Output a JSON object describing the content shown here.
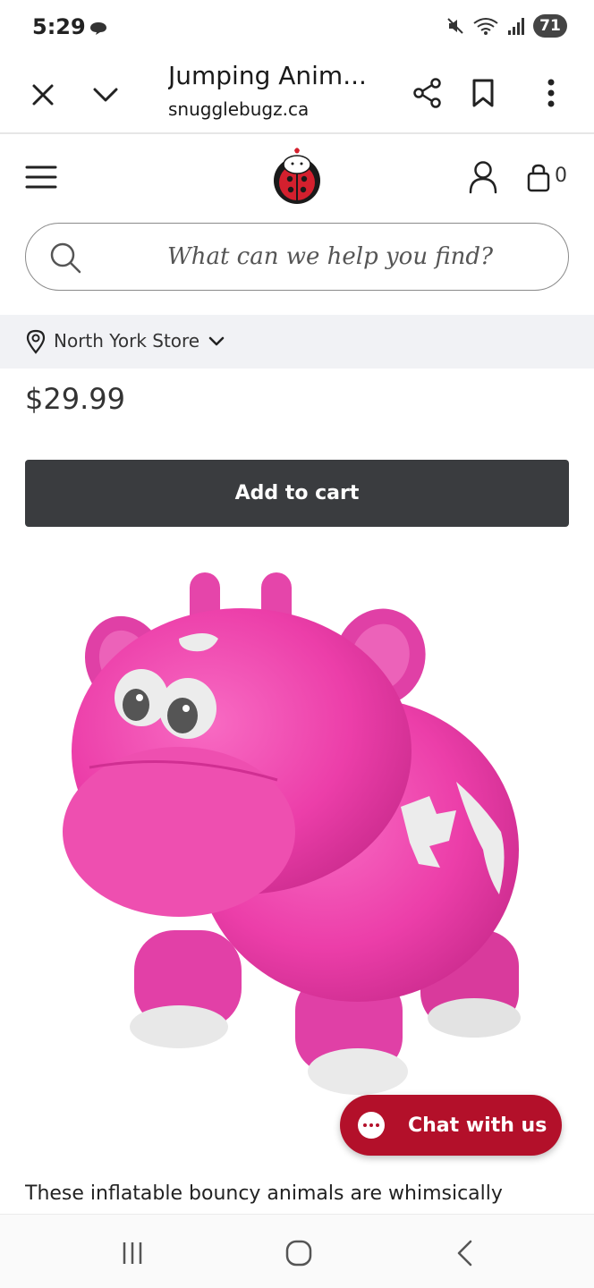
{
  "status_bar": {
    "time": "5:29",
    "battery": "71"
  },
  "browser": {
    "title": "Jumping Anim...",
    "url": "snugglebugz.ca"
  },
  "header": {
    "cart_count": "0"
  },
  "search": {
    "placeholder": "What can we help you find?"
  },
  "store": {
    "label": "North York Store"
  },
  "product": {
    "price": "$29.99",
    "add_to_cart_label": "Add to cart",
    "description": "These inflatable bouncy animals are whimsically"
  },
  "chat": {
    "label": "Chat with us"
  },
  "colors": {
    "brand_red": "#b3102a",
    "button_dark": "#3a3c3f",
    "product_pink": "#ec3ea9"
  }
}
